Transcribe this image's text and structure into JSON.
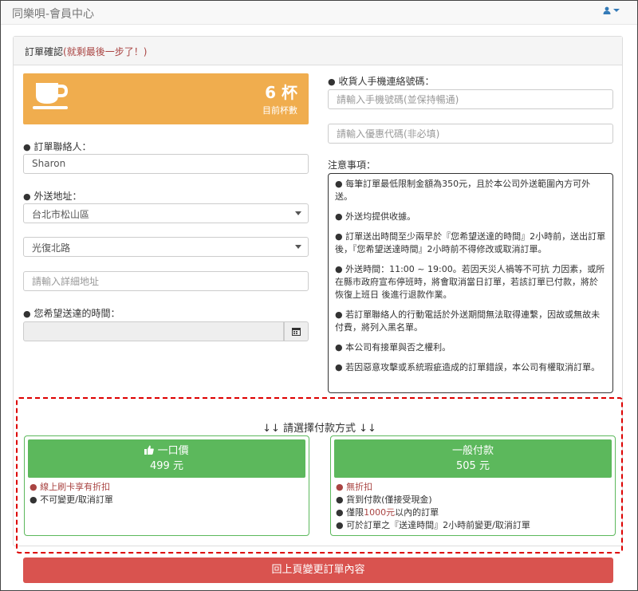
{
  "app": {
    "title": "同樂唄-會員中心"
  },
  "panel": {
    "heading": "訂單確認",
    "heading_hint": "(就剩最後一步了！)"
  },
  "cups": {
    "count": "6 杯",
    "label": "目前杯數"
  },
  "contact": {
    "label": "訂單聯絡人：",
    "value": "Sharon"
  },
  "address": {
    "label": "外送地址：",
    "district": "台北市松山區",
    "road": "光復北路",
    "detail_placeholder": "請輸入詳細地址"
  },
  "delivery_time": {
    "label": "您希望送達的時間："
  },
  "phone": {
    "label": "收貨人手機連絡號碼：",
    "placeholder": "請輸入手機號碼(並保持暢通)"
  },
  "coupon": {
    "placeholder": "請輸入優惠代碼(非必填)"
  },
  "notes": {
    "title": "注意事項：",
    "items": [
      "● 每筆訂單最低限制金額為350元，且於本公司外送範圍內方可外送。",
      "● 外送均提供收據。",
      "● 訂單送出時間至少兩早於『您希望送達的時間』2小時前，送出訂單後，『您希望送達時間』2小時前不得修改或取消訂單。",
      "● 外送時間：11:00 ~ 19:00。若因天災人禍等不可抗 力因素，或所在縣市政府宣布停班時，將會取消當日訂單，若該訂單已付款，將於恢復上班日 後進行退款作業。",
      "● 若訂單聯絡人的行動電話於外送期間無法取得連繫，因故或無故未付費，將列入黑名單。",
      "● 本公司有接單與否之權利。",
      "● 若因惡意攻擊或系統瑕疵造成的訂單錯誤，本公司有權取消訂單。"
    ]
  },
  "payment": {
    "title": "↓↓ 請選擇付款方式 ↓↓",
    "option1": {
      "label": "一口價",
      "price": "499 元",
      "perks": [
        "線上刷卡享有折扣",
        "不可變更/取消訂單"
      ]
    },
    "option2": {
      "label": "一般付款",
      "price": "505 元",
      "perks": [
        "無折扣",
        "貨到付款(僅接受現金)"
      ],
      "limit_prefix": "僅限",
      "limit_amount": "1000元",
      "limit_suffix": "以內的訂單",
      "change_rule": "可於訂單之『送達時間』2小時前變更/取消訂單"
    }
  },
  "back_button": {
    "label": "回上頁變更訂單內容"
  },
  "icons": {
    "user": "user-icon",
    "cup": "coffee-cup-icon",
    "calendar": "calendar-icon",
    "thumbs_up": "thumbs-up-icon"
  },
  "colors": {
    "warning": "#f0ad4e",
    "success": "#5cb85c",
    "danger": "#d9534f",
    "hint": "#a94442"
  }
}
